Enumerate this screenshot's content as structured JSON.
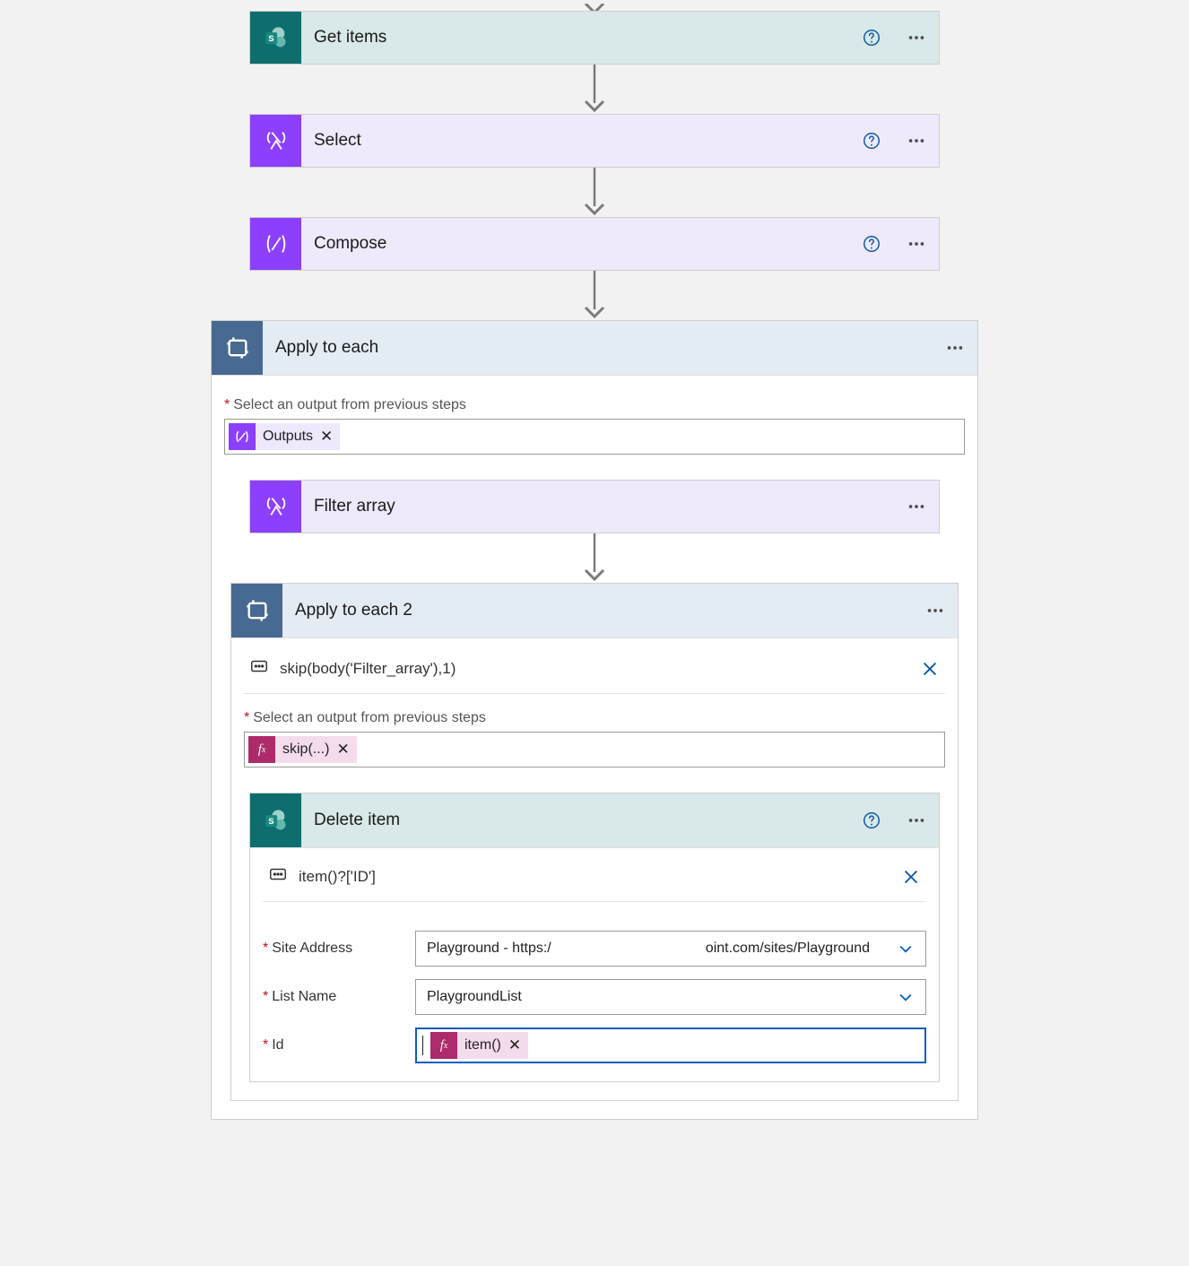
{
  "toolbar_icons": {
    "help_tooltip": "Help",
    "more_tooltip": "Menu"
  },
  "actions": {
    "get_items": {
      "title": "Get items"
    },
    "select": {
      "title": "Select"
    },
    "compose": {
      "title": "Compose"
    },
    "filter_array": {
      "title": "Filter array"
    },
    "delete_item": {
      "title": "Delete item"
    }
  },
  "apply_each": {
    "title": "Apply to each",
    "field_label": "Select an output from previous steps",
    "token": {
      "label": "Outputs"
    }
  },
  "apply_each_2": {
    "title": "Apply to each 2",
    "rename_text": "skip(body('Filter_array'),1)",
    "field_label": "Select an output from previous steps",
    "token": {
      "label": "skip(...)"
    }
  },
  "delete_item_card": {
    "rename_text": "item()?['ID']",
    "params": {
      "site_address": {
        "label": "Site Address",
        "value_left": "Playground - https:/",
        "value_right": "oint.com/sites/Playground"
      },
      "list_name": {
        "label": "List Name",
        "value": "PlaygroundList"
      },
      "id": {
        "label": "Id",
        "token": {
          "label": "item()"
        }
      }
    }
  }
}
